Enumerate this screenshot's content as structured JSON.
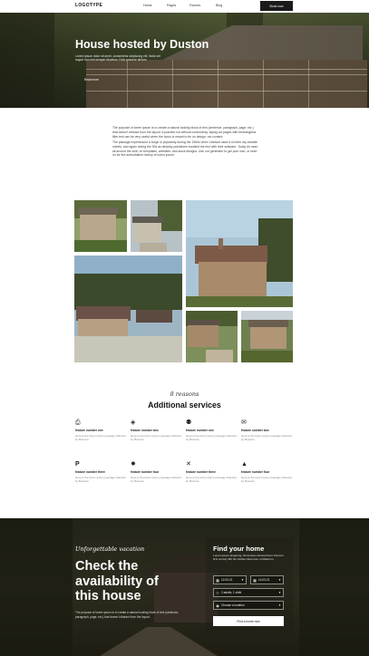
{
  "nav": {
    "logo": "LOGOTYPE",
    "links": [
      "Home",
      "Pages",
      "Futures",
      "Blog"
    ],
    "cta": "Book now"
  },
  "hero": {
    "title": "House hosted by Duston",
    "subtitle": "Lorem ipsum dolor sit amet, consectetur adipiscing elit. Nulla vel augue non nisi semper faucibus. Duis posuere dictum.",
    "link": "Read more"
  },
  "intro": {
    "p1": "The purpose of lorem ipsum is to create a natural looking block of text (sentence, paragraph, page, etc.) that doesn't distract from the layout. A practice not without controversy, laying out pages with meaningless filler text can be very useful when the focus is meant to be on design, not content.",
    "p2": "The passage experienced a surge in popularity during the 1960s when Letraset used it on their dry-transfer sheets, and again during the 90s as desktop publishers bundled the text with their software. Today it's seen all around the web; on templates, websites, and stock designs. Use our generator to get your own, or read on for the authoritative history of lorem ipsum."
  },
  "services": {
    "script": "8 reasons",
    "title": "Additional services",
    "items": [
      {
        "icon": "printer-icon",
        "glyph": "⎙",
        "title": "feature number one",
        "desc": "Here is the lorem ipsum passage followed by Boscoto"
      },
      {
        "icon": "glass-icon",
        "glyph": "◈",
        "title": "feature number two",
        "desc": "Here is the lorem ipsum passage followed by Boscoto"
      },
      {
        "icon": "people-icon",
        "glyph": "⚉",
        "title": "feature number one",
        "desc": "Here is the lorem ipsum passage followed by Boscoto"
      },
      {
        "icon": "chat-icon",
        "glyph": "✉",
        "title": "feature number two",
        "desc": "Here is the lorem ipsum passage followed by Boscoto"
      },
      {
        "icon": "parking-icon",
        "glyph": "P",
        "title": "feature number three",
        "desc": "Here is the lorem ipsum passage followed by Boscoto"
      },
      {
        "icon": "sun-icon",
        "glyph": "✹",
        "title": "feature number four",
        "desc": "Here is the lorem ipsum passage followed by Boscoto"
      },
      {
        "icon": "cutlery-icon",
        "glyph": "✕",
        "title": "feature number three",
        "desc": "Here is the lorem ipsum passage followed by Boscoto"
      },
      {
        "icon": "bell-icon",
        "glyph": "▲",
        "title": "feature number four",
        "desc": "Here is the lorem ipsum passage followed by Boscoto"
      }
    ]
  },
  "booking": {
    "script": "Unforgettable vacation",
    "title": "Check the availability of this house",
    "desc": "The purpose of lorem ipsum is to create a natural looking block of text (sentence, paragraph, page, etc.) that doesn't distract from the layout.",
    "form": {
      "title": "Find your home",
      "subtitle": "Lorem ipsum langsung. Sit ameten derived from Cicero's first century BC De Finibus Bonorum et Malorum.",
      "checkin": "12.03.21",
      "checkout": "14.03.21",
      "guests": "2 adults, 1 child",
      "location": "Choose a location",
      "button": "Find a home now"
    }
  }
}
